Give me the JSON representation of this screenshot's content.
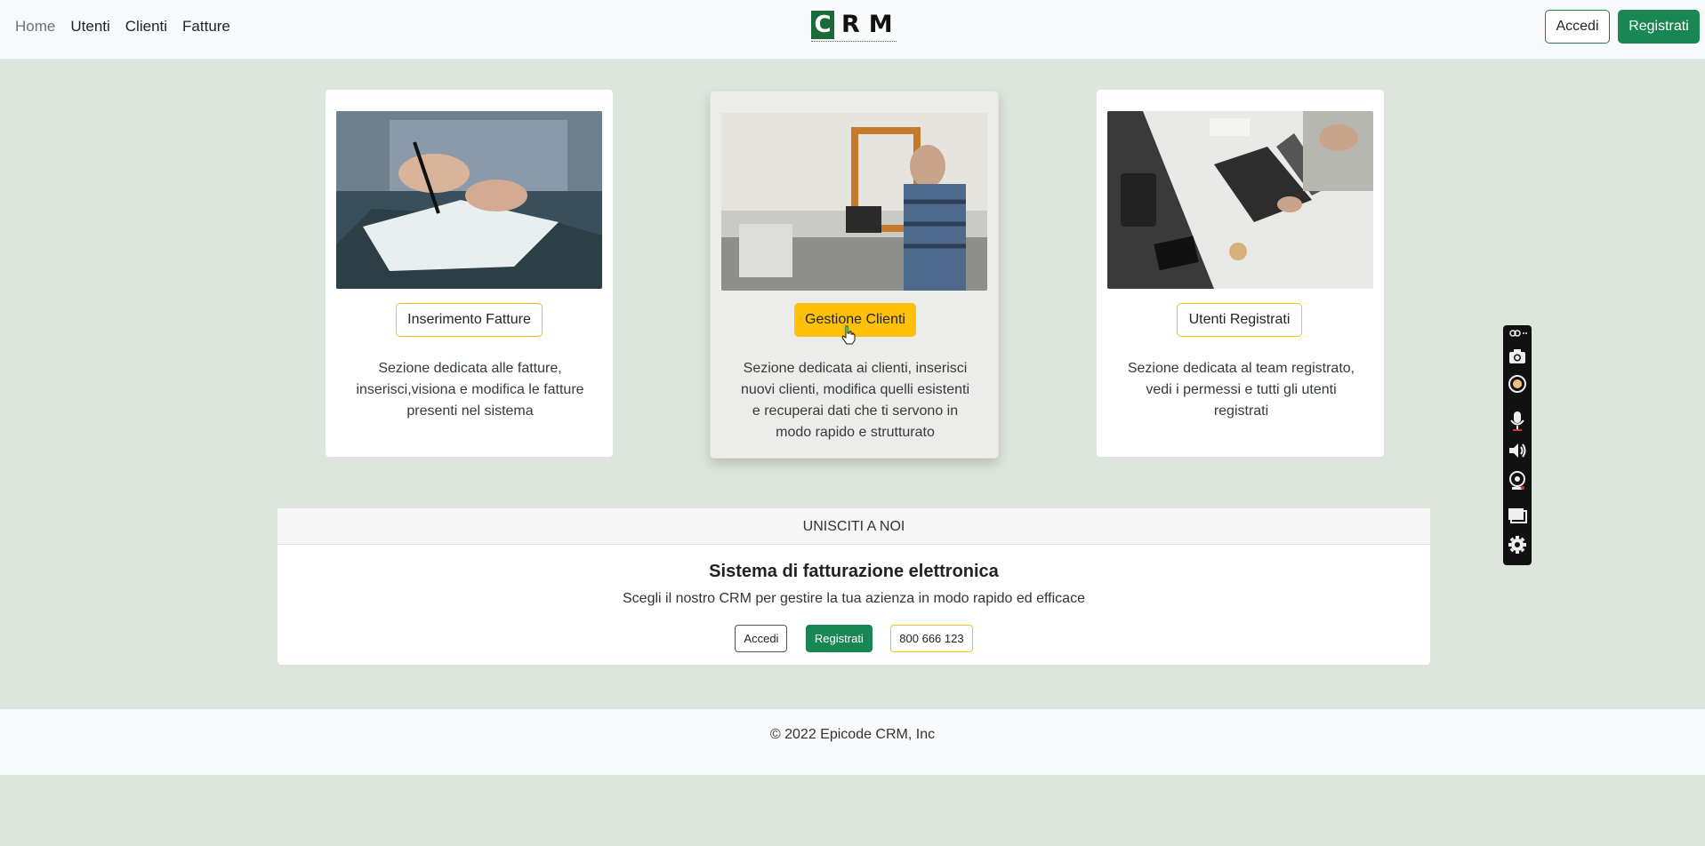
{
  "nav": {
    "links": [
      "Home",
      "Utenti",
      "Clienti",
      "Fatture"
    ],
    "active": "Home",
    "logo_letter": "C",
    "logo_text": "RM",
    "accedi": "Accedi",
    "registrati": "Registrati"
  },
  "cards": [
    {
      "button": "Inserimento Fatture",
      "text": "Sezione dedicata alle fatture, inserisci,visiona e modifica le fatture presenti nel sistema",
      "image": "person-signing-documents"
    },
    {
      "button": "Gestione Clienti",
      "text": "Sezione dedicata ai clienti, inserisci nuovi clienti, modifica quelli esistenti e recuperai dati che ti servono in modo rapido e strutturato",
      "image": "shop-cashier-at-register"
    },
    {
      "button": "Utenti Registrati",
      "text": "Sezione dedicata al team registrato, vedi i permessi e tutti gli utenti registrati",
      "image": "desk-laptop-top-view"
    }
  ],
  "join": {
    "header": "UNISCITI A NOI",
    "title": "Sistema di fatturazione elettronica",
    "subtitle": "Scegli il nostro CRM per gestire la tua azienza in modo rapido ed efficace",
    "accedi": "Accedi",
    "registrati": "Registrati",
    "phone": "800 666 123"
  },
  "footer": {
    "copyright": "© 2022 Epicode CRM, Inc"
  },
  "colors": {
    "page_bg": "#dde6dc",
    "success": "#198754",
    "warning": "#ffc107",
    "brand_green": "#1b6b3a"
  },
  "recorder": {
    "icons": [
      "link-icon",
      "camera-icon",
      "record-icon",
      "microphone-icon",
      "speaker-icon",
      "webcam-icon",
      "window-icon",
      "gear-icon"
    ]
  }
}
